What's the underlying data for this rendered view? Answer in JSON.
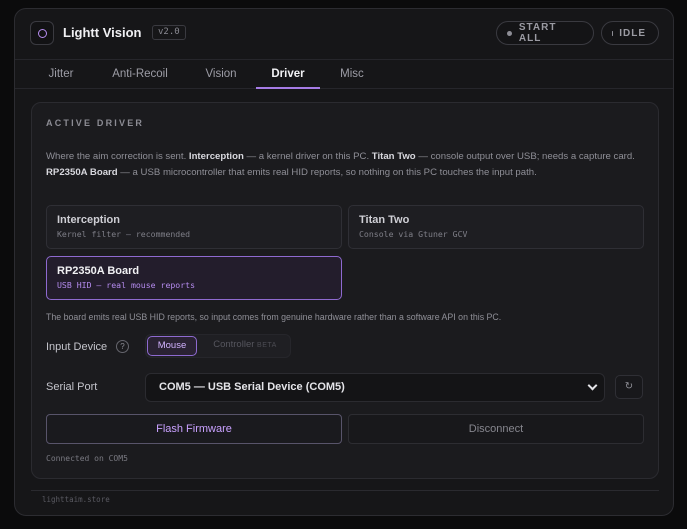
{
  "header": {
    "app_title": "Lightt Vision",
    "version": "v2.0",
    "start_all_label": "START ALL",
    "status_label": "IDLE"
  },
  "tabs": [
    {
      "label": "Jitter",
      "active": false
    },
    {
      "label": "Anti-Recoil",
      "active": false
    },
    {
      "label": "Vision",
      "active": false
    },
    {
      "label": "Driver",
      "active": true
    },
    {
      "label": "Misc",
      "active": false
    }
  ],
  "driver": {
    "section_title": "ACTIVE DRIVER",
    "description": {
      "p1": "Where the aim correction is sent. ",
      "b1": "Interception",
      "p2": " — a kernel driver on this PC. ",
      "b2": "Titan Two",
      "p3": " — console output over USB; needs a capture card. ",
      "b3": "RP2350A Board",
      "p4": " — a USB microcontroller that emits real HID reports, so nothing on this PC touches the input path."
    },
    "options": [
      {
        "name": "Interception",
        "sub": "Kernel filter — recommended",
        "selected": false
      },
      {
        "name": "Titan Two",
        "sub": "Console via Gtuner GCV",
        "selected": false
      },
      {
        "name": "RP2350A Board",
        "sub": "USB HID — real mouse reports",
        "selected": true
      }
    ],
    "note": "The board emits real USB HID reports, so input comes from genuine hardware rather than a software API on this PC.",
    "input_device": {
      "label": "Input Device",
      "help": "?",
      "mouse_label": "Mouse",
      "controller_label": "Controller",
      "controller_badge": "BETA"
    },
    "serial_port": {
      "label": "Serial Port",
      "selected": "COM5 — USB Serial Device (COM5)",
      "refresh_glyph": "↻"
    },
    "flash_label": "Flash Firmware",
    "disconnect_label": "Disconnect",
    "status": "Connected on COM5"
  },
  "footer": {
    "text": "lighttaim.store"
  },
  "colors": {
    "accent": "#a67ce6",
    "accent_text": "#c9a1ff",
    "background": "#161618"
  }
}
